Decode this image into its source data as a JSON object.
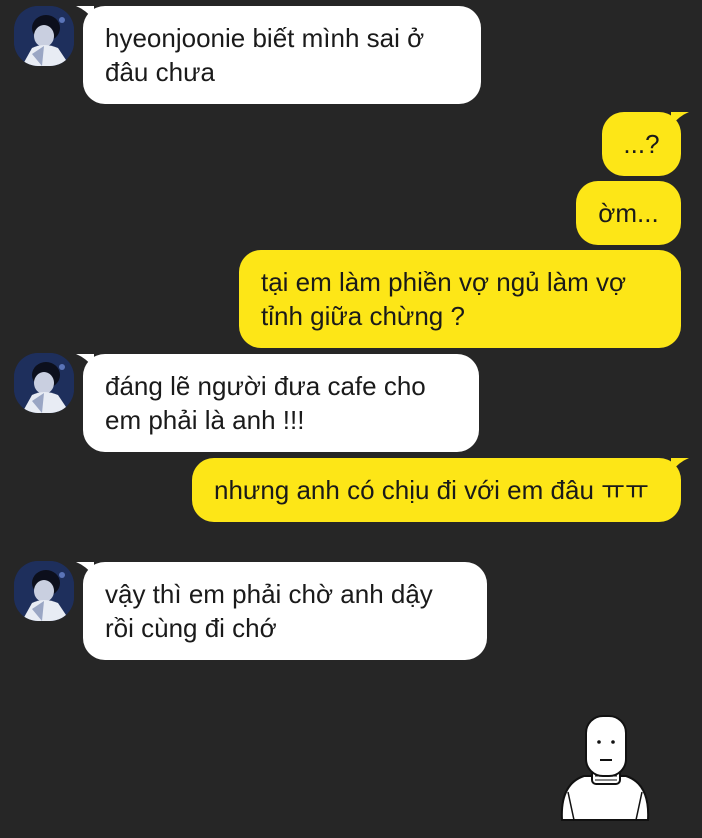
{
  "colors": {
    "background": "#262626",
    "incoming_bubble": "#ffffff",
    "outgoing_bubble": "#fde617",
    "text": "#1a1a1a"
  },
  "messages": [
    {
      "side": "in",
      "text": "hyeonjoonie biết mình sai ở đâu chưa"
    },
    {
      "side": "out",
      "text": "...?"
    },
    {
      "side": "out",
      "text": "ờm..."
    },
    {
      "side": "out",
      "text": "tại em làm phiền vợ ngủ làm vợ tỉnh giữa chừng ?"
    },
    {
      "side": "in",
      "text": "đáng lẽ người đưa cafe cho em phải là anh !!!"
    },
    {
      "side": "out",
      "text": "nhưng anh có chịu đi với em đâu ㅠㅠ"
    },
    {
      "side": "in",
      "text": "vậy thì em phải chờ anh dậy rồi cùng đi chớ"
    }
  ],
  "avatar_icon": "profile-avatar-icon",
  "sticker_icon": "plain-character-sticker-icon"
}
